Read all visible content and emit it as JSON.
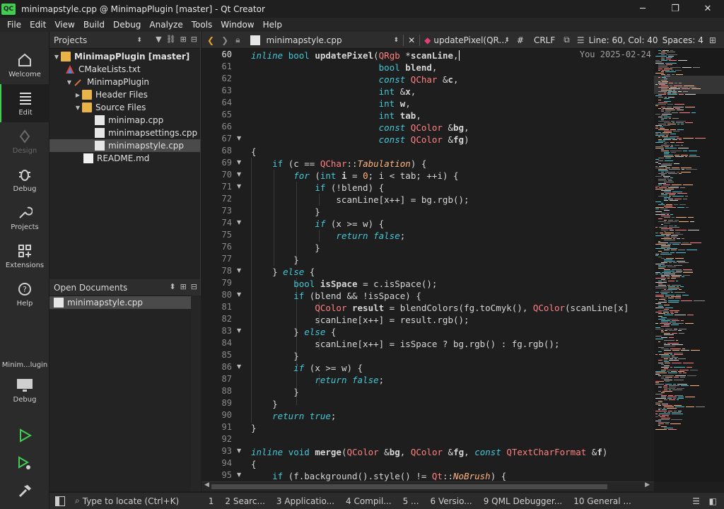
{
  "window": {
    "title": "minimapstyle.cpp @ MinimapPlugin [master] - Qt Creator",
    "logo_text": "QC",
    "minimize": "─",
    "restore": "❐",
    "close": "✕"
  },
  "menu": [
    "File",
    "Edit",
    "View",
    "Build",
    "Debug",
    "Analyze",
    "Tools",
    "Window",
    "Help"
  ],
  "modes": {
    "welcome": "Welcome",
    "edit": "Edit",
    "design": "Design",
    "debug": "Debug",
    "projects": "Projects",
    "extensions": "Extensions",
    "help": "Help",
    "kit": "Minim...lugin",
    "kit_target": "Debug"
  },
  "projects_pane": {
    "title": "Projects",
    "tree": [
      {
        "label": "MinimapPlugin [master]",
        "kind": "project"
      },
      {
        "label": "CMakeLists.txt",
        "kind": "cmake"
      },
      {
        "label": "MinimapPlugin",
        "kind": "target"
      },
      {
        "label": "Header Files",
        "kind": "folder"
      },
      {
        "label": "Source Files",
        "kind": "folder"
      },
      {
        "label": "minimap.cpp",
        "kind": "cpp"
      },
      {
        "label": "minimapsettings.cpp",
        "kind": "cpp"
      },
      {
        "label": "minimapstyle.cpp",
        "kind": "cpp"
      },
      {
        "label": "README.md",
        "kind": "md"
      }
    ]
  },
  "open_documents": {
    "title": "Open Documents",
    "items": [
      "minimapstyle.cpp"
    ]
  },
  "editor_toolbar": {
    "file": "minimapstyle.cpp",
    "symbol": "updatePixel(QR...",
    "hash": "#",
    "line_ending": "CRLF",
    "position": "Line: 60, Col: 40",
    "spaces": "Spaces: 4"
  },
  "editor": {
    "blame": "You 2025-02-24",
    "line_numbers": [
      "60",
      "61",
      "62",
      "63",
      "64",
      "65",
      "66",
      "67",
      "68",
      "69",
      "70",
      "71",
      "72",
      "73",
      "74",
      "75",
      "76",
      "77",
      "78",
      "79",
      "80",
      "81",
      "82",
      "83",
      "84",
      "85",
      "86",
      "87",
      "88",
      "89",
      "90",
      "91",
      "92",
      "93",
      "94",
      "95"
    ]
  },
  "statusbar": {
    "locator": "Type to locate (Ctrl+K)",
    "tabs": [
      "1",
      "2 Searc...",
      "3 Applicatio...",
      "4 Compil...",
      "5 ...",
      "6 Versio...",
      "9 QML Debugger...",
      "10 General ..."
    ]
  },
  "colors": {
    "accent": "#41cd52",
    "keyword": "#45c6d6",
    "type": "#ff8080",
    "enum": "#ffb380"
  }
}
